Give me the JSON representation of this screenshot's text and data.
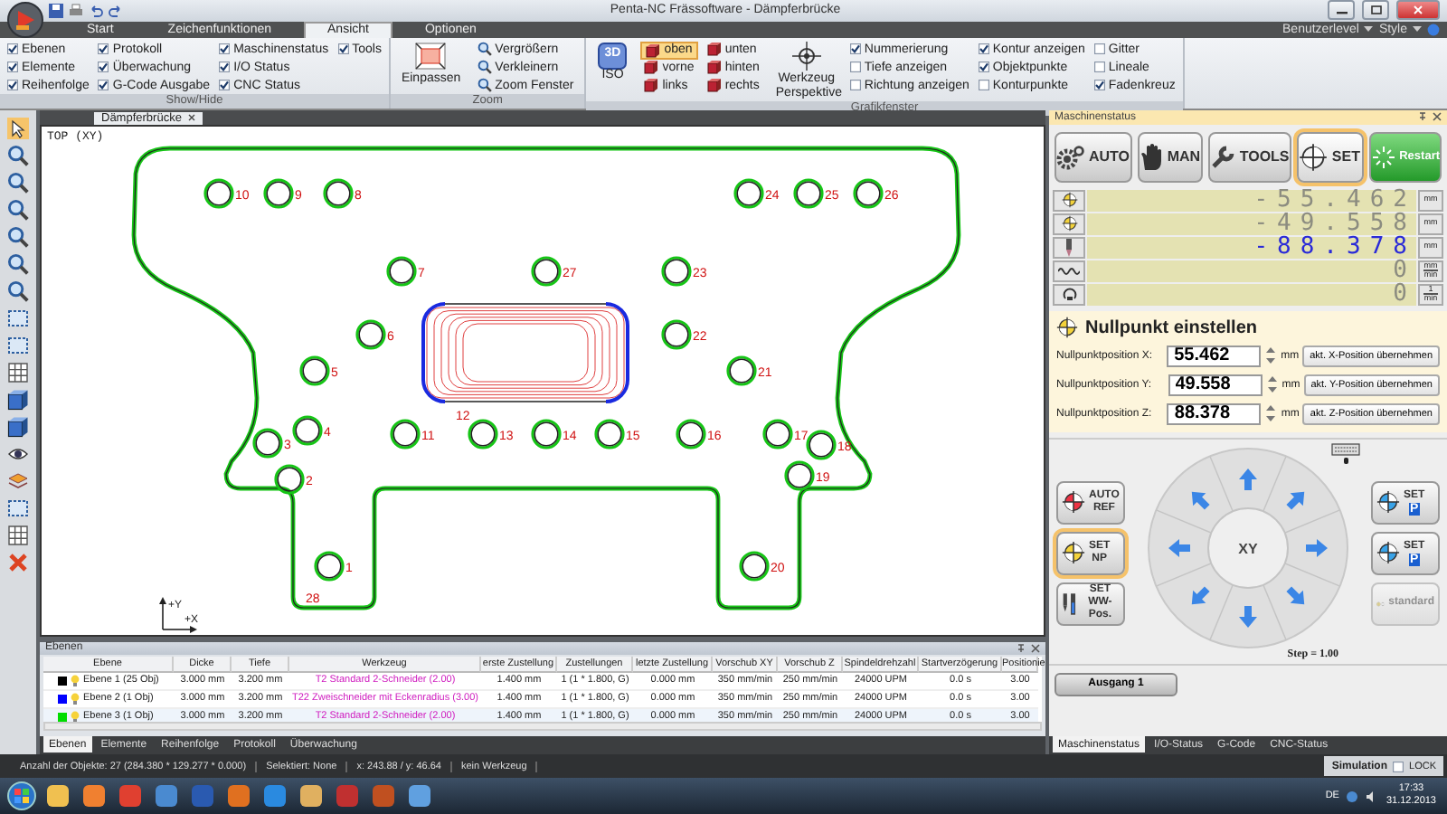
{
  "window": {
    "title": "Penta-NC Frässoftware - Dämpferbrücke"
  },
  "ribbon_tabs": [
    {
      "label": "Start",
      "selected": false
    },
    {
      "label": "Zeichenfunktionen",
      "selected": false
    },
    {
      "label": "Ansicht",
      "selected": true
    },
    {
      "label": "Optionen",
      "selected": false
    }
  ],
  "ribbon_menus": [
    "Benutzerlevel",
    "Style"
  ],
  "show_hide": {
    "label": "Show/Hide",
    "columns": [
      [
        {
          "label": "Ebenen",
          "checked": true
        },
        {
          "label": "Elemente",
          "checked": true
        },
        {
          "label": "Reihenfolge",
          "checked": true
        }
      ],
      [
        {
          "label": "Protokoll",
          "checked": true
        },
        {
          "label": "Überwachung",
          "checked": true
        },
        {
          "label": "G-Code Ausgabe",
          "checked": true
        }
      ],
      [
        {
          "label": "Maschinenstatus",
          "checked": true
        },
        {
          "label": "I/O Status",
          "checked": true
        },
        {
          "label": "CNC Status",
          "checked": true
        }
      ],
      [
        {
          "label": "Tools",
          "checked": true
        }
      ]
    ]
  },
  "zoom": {
    "label": "Zoom",
    "fit": "Einpassen",
    "items": [
      "Vergrößern",
      "Verkleinern",
      "Zoom Fenster"
    ]
  },
  "graphics": {
    "label": "Grafikfenster",
    "iso_badge": "3D",
    "iso": "ISO",
    "views": [
      {
        "label": "oben",
        "selected": true
      },
      {
        "label": "vorne",
        "selected": false
      },
      {
        "label": "links",
        "selected": false
      },
      {
        "label": "unten",
        "selected": false
      },
      {
        "label": "hinten",
        "selected": false
      },
      {
        "label": "rechts",
        "selected": false
      }
    ],
    "perspective": "Werkzeug Perspektive",
    "columns": [
      [
        {
          "label": "Nummerierung",
          "checked": true
        },
        {
          "label": "Tiefe anzeigen",
          "checked": false
        },
        {
          "label": "Richtung anzeigen",
          "checked": false
        }
      ],
      [
        {
          "label": "Kontur anzeigen",
          "checked": true
        },
        {
          "label": "Objektpunkte",
          "checked": true
        },
        {
          "label": "Konturpunkte",
          "checked": false
        }
      ],
      [
        {
          "label": "Gitter",
          "checked": false
        },
        {
          "label": "Lineale",
          "checked": false
        },
        {
          "label": "Fadenkreuz",
          "checked": true
        }
      ]
    ]
  },
  "document_tab": {
    "label": "Dämpferbrücke"
  },
  "canvas": {
    "view_label": "TOP (XY)",
    "axis_y": "+Y",
    "axis_x": "+X",
    "objects": [
      {
        "kind": "drill",
        "label": "10"
      },
      {
        "kind": "drill",
        "label": "9"
      },
      {
        "kind": "drill",
        "label": "8"
      },
      {
        "kind": "drill",
        "label": "24"
      },
      {
        "kind": "drill",
        "label": "25"
      },
      {
        "kind": "drill",
        "label": "26"
      },
      {
        "kind": "drill",
        "label": "7"
      },
      {
        "kind": "drill",
        "label": "27"
      },
      {
        "kind": "drill",
        "label": "23"
      },
      {
        "kind": "drill",
        "label": "6"
      },
      {
        "kind": "drill",
        "label": "22"
      },
      {
        "kind": "drill",
        "label": "5"
      },
      {
        "kind": "drill",
        "label": "21"
      },
      {
        "kind": "pocket",
        "label": "12"
      },
      {
        "kind": "drill",
        "label": "4"
      },
      {
        "kind": "drill",
        "label": "11"
      },
      {
        "kind": "drill",
        "label": "13"
      },
      {
        "kind": "drill",
        "label": "14"
      },
      {
        "kind": "drill",
        "label": "15"
      },
      {
        "kind": "drill",
        "label": "16"
      },
      {
        "kind": "drill",
        "label": "17"
      },
      {
        "kind": "drill",
        "label": "3"
      },
      {
        "kind": "drill",
        "label": "18"
      },
      {
        "kind": "drill",
        "label": "2"
      },
      {
        "kind": "drill",
        "label": "19"
      },
      {
        "kind": "drill",
        "label": "1"
      },
      {
        "kind": "drill",
        "label": "20"
      },
      {
        "kind": "contour",
        "label": "28"
      }
    ]
  },
  "layers_panel": {
    "title": "Ebenen",
    "columns": [
      "Ebene",
      "Dicke",
      "Tiefe",
      "Werkzeug",
      "erste Zustellung",
      "Zustellungen",
      "letzte Zustellung",
      "Vorschub XY",
      "Vorschub Z",
      "Spindeldrehzahl",
      "Startverzögerung",
      "Positionie"
    ],
    "rows": [
      {
        "color": "#000000",
        "selected": false,
        "cells": [
          "Ebene 1 (25 Obj)",
          "3.000 mm",
          "3.200 mm",
          "T2 Standard 2-Schneider (2.00)",
          "1.400 mm",
          "1 (1 * 1.800, G)",
          "0.000 mm",
          "350 mm/min",
          "250 mm/min",
          "24000 UPM",
          "0.0 s",
          "3.00"
        ]
      },
      {
        "color": "#0000ff",
        "selected": false,
        "cells": [
          "Ebene 2 (1 Obj)",
          "3.000 mm",
          "3.200 mm",
          "T22 Zweischneider mit Eckenradius (3.00)",
          "1.400 mm",
          "1 (1 * 1.800, G)",
          "0.000 mm",
          "350 mm/min",
          "250 mm/min",
          "24000 UPM",
          "0.0 s",
          "3.00"
        ]
      },
      {
        "color": "#00dd00",
        "selected": true,
        "cells": [
          "Ebene 3 (1 Obj)",
          "3.000 mm",
          "3.200 mm",
          "T2 Standard 2-Schneider (2.00)",
          "1.400 mm",
          "1 (1 * 1.800, G)",
          "0.000 mm",
          "350 mm/min",
          "250 mm/min",
          "24000 UPM",
          "0.0 s",
          "3.00"
        ]
      }
    ],
    "tabs": [
      {
        "label": "Ebenen",
        "selected": true
      },
      {
        "label": "Elemente",
        "selected": false
      },
      {
        "label": "Reihenfolge",
        "selected": false
      },
      {
        "label": "Protokoll",
        "selected": false
      },
      {
        "label": "Überwachung",
        "selected": false
      }
    ]
  },
  "machine_panel": {
    "title": "Maschinenstatus",
    "modes": [
      {
        "kind": "auto",
        "label": "AUTO",
        "selected": false
      },
      {
        "kind": "man",
        "label": "MAN",
        "selected": false
      },
      {
        "kind": "tools",
        "label": "TOOLS",
        "selected": false
      },
      {
        "kind": "set",
        "label": "SET",
        "selected": true
      },
      {
        "kind": "restart",
        "label": "Restart",
        "selected": false
      }
    ],
    "readouts": [
      {
        "kind": "axis",
        "value": "-55.462",
        "unit": [
          "mm"
        ],
        "active": false
      },
      {
        "kind": "axis",
        "value": "-49.558",
        "unit": [
          "mm"
        ],
        "active": false
      },
      {
        "kind": "tool",
        "value": "-88.378",
        "unit": [
          "mm"
        ],
        "active": true
      },
      {
        "kind": "feed",
        "value": "0",
        "unit": [
          "mm",
          "min"
        ],
        "active": false
      },
      {
        "kind": "spindle",
        "value": "0",
        "unit": [
          "1",
          "min"
        ],
        "active": false
      }
    ],
    "zero_point": {
      "title": "Nullpunkt einstellen",
      "rows": [
        {
          "label": "Nullpunktposition X:",
          "value": "55.462",
          "unit": "mm",
          "button": "akt. X-Position übernehmen"
        },
        {
          "label": "Nullpunktposition Y:",
          "value": "49.558",
          "unit": "mm",
          "button": "akt. Y-Position übernehmen"
        },
        {
          "label": "Nullpunktposition Z:",
          "value": "88.378",
          "unit": "mm",
          "button": "akt. Z-Position übernehmen"
        }
      ]
    },
    "left_buttons": [
      {
        "kind": "ref",
        "top": "AUTO",
        "bottom": "REF",
        "selected": false
      },
      {
        "kind": "np",
        "top": "SET",
        "bottom": "NP",
        "selected": true
      },
      {
        "kind": "ww",
        "top": "SET",
        "bottom": "WW-Pos.",
        "selected": false
      }
    ],
    "right_buttons": [
      {
        "kind": "p",
        "top": "SET",
        "badge": "P",
        "disabled": false
      },
      {
        "kind": "p2",
        "top": "SET",
        "badge": "P",
        "disabled": false
      },
      {
        "kind": "standard",
        "badge": "standard",
        "disabled": true
      }
    ],
    "jog_center": "XY",
    "step": "Step = 1.00",
    "output_button": "Ausgang 1",
    "tabs": [
      {
        "label": "Maschinenstatus",
        "selected": true
      },
      {
        "label": "I/O-Status",
        "selected": false
      },
      {
        "label": "G-Code",
        "selected": false
      },
      {
        "label": "CNC-Status",
        "selected": false
      }
    ]
  },
  "status_bar": {
    "items": [
      "Anzahl der Objekte: 27 (284.380 * 129.277 * 0.000)",
      "Selektiert: None",
      "x:  243.88 / y:   46.64",
      "kein Werkzeug"
    ],
    "mode": "Simulation",
    "lock": {
      "label": "LOCK",
      "checked": false
    }
  },
  "taskbar": {
    "language": "DE",
    "time": "17:33",
    "date": "31.12.2013"
  }
}
